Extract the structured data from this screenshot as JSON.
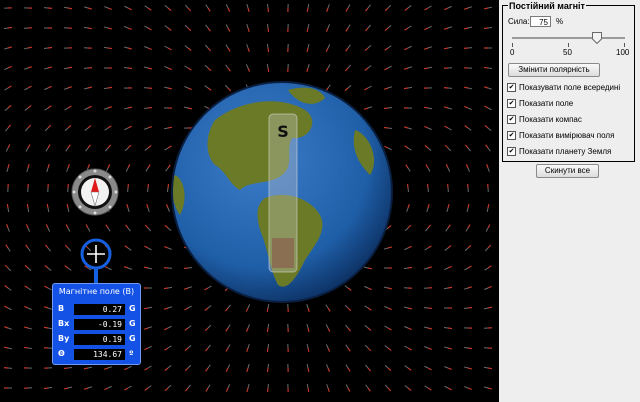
{
  "panel": {
    "group_title": "Постійний магніт",
    "strength_label": "Сила:",
    "strength_value": "75",
    "strength_unit": "%",
    "slider": {
      "value": 75,
      "min_label": "0",
      "mid_label": "50",
      "max_label": "100"
    },
    "flip_polarity_button": "Змінити полярність",
    "checkboxes": [
      {
        "label": "Показувати поле всередині",
        "checked": true
      },
      {
        "label": "Показати поле",
        "checked": true
      },
      {
        "label": "Показати компас",
        "checked": true
      },
      {
        "label": "Показати вимірювач поля",
        "checked": true
      },
      {
        "label": "Показати планету Земля",
        "checked": true
      }
    ],
    "reset_button": "Скинути все"
  },
  "magnet": {
    "pole_label": "S"
  },
  "meter": {
    "title": "Магнітне поле (B)",
    "rows": [
      {
        "label": "B",
        "value": "0.27",
        "unit": "G"
      },
      {
        "label": "Bx",
        "value": "-0.19",
        "unit": "G"
      },
      {
        "label": "By",
        "value": "0.19",
        "unit": "G"
      },
      {
        "label": "Θ",
        "value": "134.67",
        "unit": "º"
      }
    ]
  },
  "colors": {
    "field_north": "#c0392b",
    "field_south": "#ecf0f1",
    "meter_bg": "#1452e6",
    "ocean": "#1f5fa8",
    "land": "#6f7f2a"
  }
}
